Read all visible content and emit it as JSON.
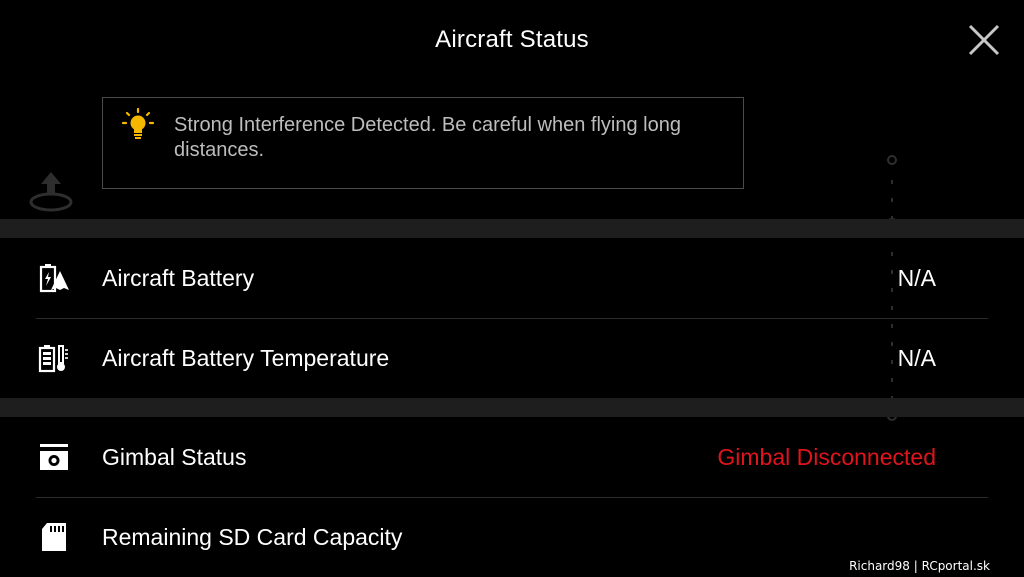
{
  "header": {
    "title": "Aircraft Status"
  },
  "warning": {
    "icon": "lightbulb-icon",
    "text": "Strong Interference Detected. Be careful when flying long distances."
  },
  "rows": [
    {
      "icon": "aircraft-battery-icon",
      "label": "Aircraft Battery",
      "value": "N/A"
    },
    {
      "icon": "battery-temperature-icon",
      "label": "Aircraft Battery Temperature",
      "value": "N/A"
    },
    {
      "icon": "gimbal-icon",
      "label": "Gimbal Status",
      "value": "Gimbal Disconnected"
    },
    {
      "icon": "sd-card-icon",
      "label": "Remaining SD Card Capacity",
      "value": ""
    }
  ],
  "colors": {
    "background": "#000000",
    "error": "#e0141c",
    "bulb": "#f5b800",
    "band": "#1e1e1e"
  },
  "watermark": "Richard98 | RCportal.sk"
}
